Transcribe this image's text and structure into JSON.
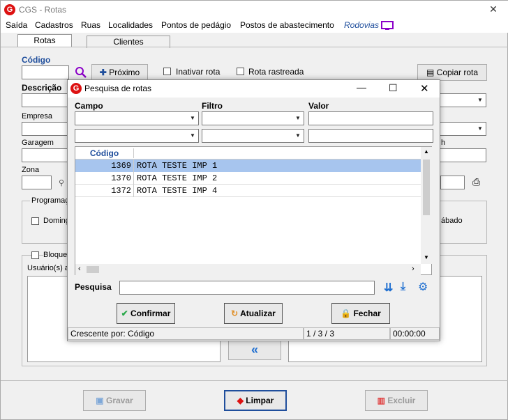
{
  "app": {
    "title": "CGS - Rotas",
    "logo_letter": "G"
  },
  "menu": [
    "Saída",
    "Cadastros",
    "Ruas",
    "Localidades",
    "Pontos de pedágio",
    "Postos de abastecimento",
    "Rodovias"
  ],
  "tabs": [
    "Rotas",
    "Clientes"
  ],
  "form": {
    "codigo_label": "Código",
    "proximo_label": "Próximo",
    "inativar_label": "Inativar rota",
    "rastreada_label": "Rota rastreada",
    "copiar_label": "Copiar rota",
    "descricao_label": "Descrição",
    "empresa_label": "Empresa",
    "garagem_label": "Garagem",
    "zona_label": "Zona",
    "programacao_label": "Programaç",
    "domingo_label": "Doming",
    "sabado_label": "ábado",
    "bloqueio_label": "Bloque",
    "usuarios_label": "Usuário(s) a",
    "partial_label_right": "h"
  },
  "dialog": {
    "title": "Pesquisa de rotas",
    "campo_label": "Campo",
    "filtro_label": "Filtro",
    "valor_label": "Valor",
    "grid_header": "Código",
    "rows": [
      {
        "codigo": "1369",
        "nome": "ROTA TESTE IMP 1"
      },
      {
        "codigo": "1370",
        "nome": "ROTA TESTE IMP 2"
      },
      {
        "codigo": "1372",
        "nome": "ROTA TESTE IMP 4"
      }
    ],
    "pesquisa_label": "Pesquisa",
    "confirmar_label": "Confirmar",
    "atualizar_label": "Atualizar",
    "fechar_label": "Fechar",
    "status_order": "Crescente por: Código",
    "status_count": "1 / 3 / 3",
    "status_time": "00:00:00"
  },
  "bottom": {
    "gravar_label": "Gravar",
    "limpar_label": "Limpar",
    "excluir_label": "Excluir"
  },
  "colors": {
    "accent": "#1f4e9c",
    "selected_row": "#a7c5ee",
    "purple": "#8b00c8"
  }
}
